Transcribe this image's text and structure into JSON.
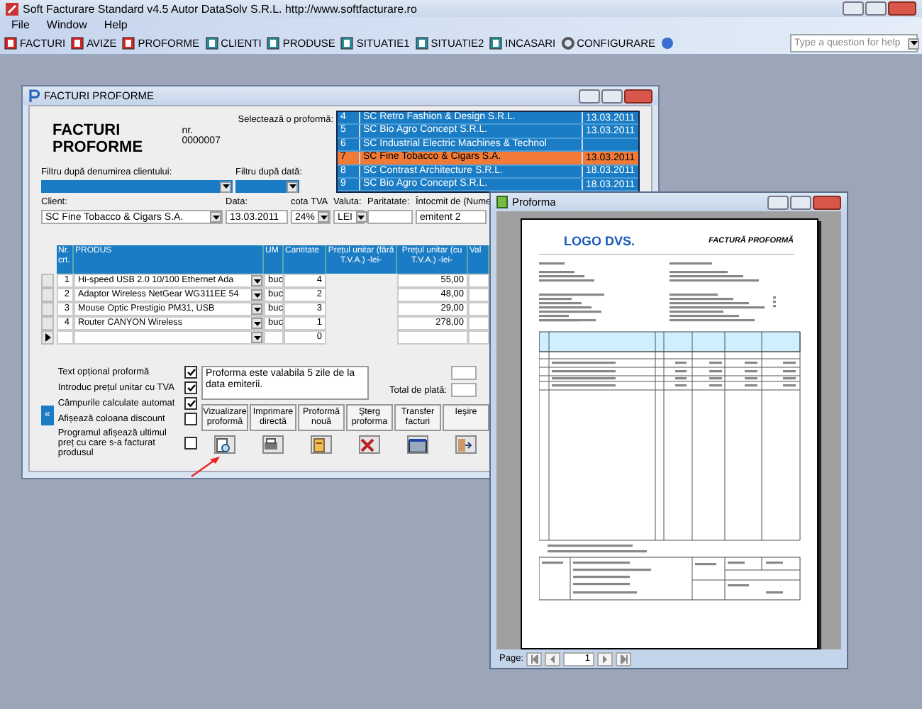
{
  "app": {
    "title": "Soft Facturare Standard v4.5 Autor DataSolv S.R.L. http://www.softfacturare.ro"
  },
  "menu": [
    "File",
    "Window",
    "Help"
  ],
  "toolbar": [
    {
      "label": "FACTURI",
      "kind": "red"
    },
    {
      "label": "AVIZE",
      "kind": "red"
    },
    {
      "label": "PROFORME",
      "kind": "red"
    },
    {
      "label": "CLIENTI",
      "kind": "teal"
    },
    {
      "label": "PRODUSE",
      "kind": "teal"
    },
    {
      "label": "SITUATIE1",
      "kind": "teal"
    },
    {
      "label": "SITUATIE2",
      "kind": "teal"
    },
    {
      "label": "INCASARI",
      "kind": "teal"
    },
    {
      "label": "CONFIGURARE",
      "kind": "gear"
    }
  ],
  "help_search": {
    "placeholder": "Type a question for help"
  },
  "form": {
    "title": "FACTURI PROFORME",
    "heading": "FACTURI PROFORME",
    "number": "nr. 0000007",
    "select_label": "Selectează o proformă:",
    "list": [
      {
        "number": "4",
        "name": "SC Retro Fashion & Design S.R.L.",
        "date": "13.03.2011",
        "selected": false
      },
      {
        "number": "5",
        "name": "SC Bio Agro Concept S.R.L.",
        "date": "13.03.2011",
        "selected": false
      },
      {
        "number": "6",
        "name": "SC Industrial Electric Machines & Technol",
        "selected": false
      },
      {
        "number": "7",
        "name": "SC Fine Tobacco & Cigars S.A.",
        "date": "13.03.2011",
        "selected": true
      },
      {
        "number": "8",
        "name": "SC Contrast Architecture S.R.L.",
        "date": "18.03.2011",
        "selected": false
      },
      {
        "number": "9",
        "name": "SC Bio Agro Concept S.R.L.",
        "date": "18.03.2011",
        "selected": false
      }
    ],
    "filters": [
      {
        "label": "Filtru după denumirea clientului:"
      },
      {
        "label": "Filtru după dată:"
      }
    ],
    "fields": [
      {
        "label": "Client:",
        "value": "SC Fine Tobacco & Cigars S.A.",
        "dropdown": true
      },
      {
        "label": "Data:",
        "value": "13.03.2011",
        "dropdown": false
      },
      {
        "label": "cota TVA",
        "value": "24%",
        "dropdown": true
      },
      {
        "label": "Valuta:",
        "value": "LEI",
        "dropdown": true
      },
      {
        "label": "Paritatate:",
        "dropdown": false
      },
      {
        "label": "Întocmit de (Nume",
        "value": "emitent 2",
        "dropdown": false
      }
    ],
    "columns": [
      "Nr. crt.",
      "PRODUS",
      "UM",
      "Cantitate",
      "Prețul unitar (fără T.V.A.) -lei-",
      "Prețul unitar (cu T.V.A.) -lei-",
      "Val"
    ],
    "rows": [
      {
        "nr": "1",
        "product": "Hi-speed USB 2.0 10/100 Ethernet Ada",
        "um": "buc",
        "qty": "4",
        "price_vat": "55,00"
      },
      {
        "nr": "2",
        "product": "Adaptor Wireless NetGear WG311EE 54",
        "um": "buc",
        "qty": "2",
        "price_vat": "48,00"
      },
      {
        "nr": "3",
        "product": "Mouse Optic Prestigio PM31, USB",
        "um": "buc",
        "qty": "3",
        "price_vat": "29,00"
      },
      {
        "nr": "4",
        "product": "Router CANYON Wireless",
        "um": "buc",
        "qty": "1",
        "price_vat": "278,00"
      }
    ],
    "new_row": {
      "qty": "0"
    },
    "options": [
      {
        "label": "Text opțional proformă",
        "checked": true
      },
      {
        "label": "Introduc prețul unitar cu TVA",
        "checked": true
      },
      {
        "label": "Câmpurile calculate automat",
        "checked": true
      },
      {
        "label": "Afișează coloana discount",
        "checked": false
      },
      {
        "label": "Programul afișează ultimul preț cu care s-a facturat produsul",
        "checked": false
      }
    ],
    "collapse_button": "«",
    "note": "Proforma este valabila 5 zile de la data emiterii.",
    "total_label": "Total de plată:",
    "actions": [
      {
        "label": "Vizualizare proformă",
        "kind": "preview"
      },
      {
        "label": "Imprimare directă",
        "kind": "print"
      },
      {
        "label": "Proformă nouă",
        "kind": "new"
      },
      {
        "label": "Şterg proforma",
        "kind": "delete"
      },
      {
        "label": "Transfer facturi",
        "kind": "transfer"
      },
      {
        "label": "Ieşire",
        "kind": "exit"
      }
    ]
  },
  "preview": {
    "title": "Proforma",
    "logo": "LOGO DVS.",
    "doc_title": "FACTURĂ PROFORMĂ",
    "page_label": "Page:",
    "page": "1"
  }
}
